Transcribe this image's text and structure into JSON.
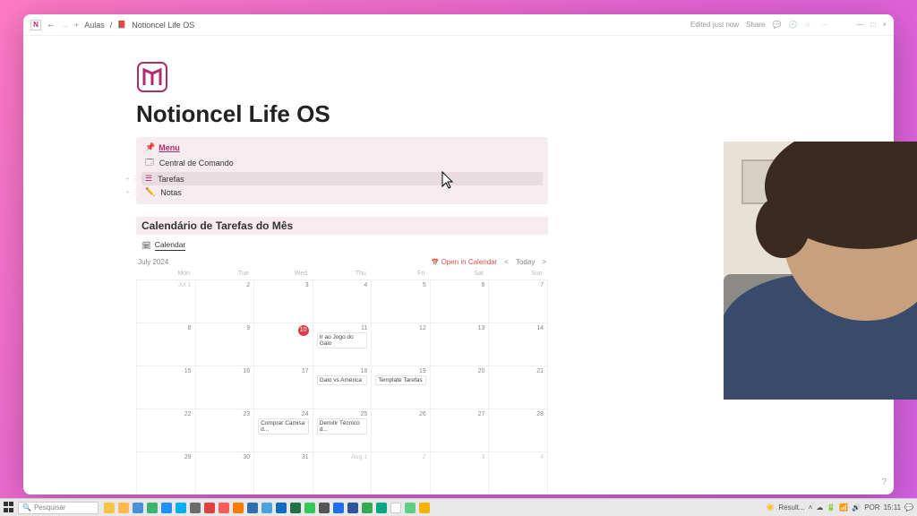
{
  "breadcrumbs": {
    "parent": "Aulas",
    "page": "Notioncel Life OS"
  },
  "toolbar": {
    "edited": "Edited just now",
    "share": "Share"
  },
  "page_title": "Notioncel Life OS",
  "menu": {
    "heading": "Menu",
    "central": "Central de Comando",
    "tarefas": "Tarefas",
    "notas": "Notas"
  },
  "calendar_section": "Calendário de Tarefas do Mês",
  "view_tab": "Calendar",
  "month_label": "July 2024",
  "open_in_calendar": "Open in Calendar",
  "today_label": "Today",
  "weekdays": [
    "Mon",
    "Tue",
    "Wed",
    "Thu",
    "Fri",
    "Sat",
    "Sun"
  ],
  "cells": {
    "r0c0": "Jul 1",
    "r0c1": "2",
    "r0c2": "3",
    "r0c3": "4",
    "r0c4": "5",
    "r0c5": "6",
    "r0c6": "7",
    "r1c0": "8",
    "r1c1": "9",
    "r1c2_today": "10",
    "r1c3": "11",
    "r1c4": "12",
    "r1c5": "13",
    "r1c6": "14",
    "r2c0": "15",
    "r2c1": "16",
    "r2c2": "17",
    "r2c3": "18",
    "r2c4": "19",
    "r2c5": "20",
    "r2c6": "21",
    "r3c0": "22",
    "r3c1": "23",
    "r3c2": "24",
    "r3c3": "25",
    "r3c4": "26",
    "r3c5": "27",
    "r3c6": "28",
    "r4c0": "29",
    "r4c1": "30",
    "r4c2": "31",
    "r4c3": "Aug 1",
    "r4c4": "2",
    "r4c5": "3",
    "r4c6": "4"
  },
  "events": {
    "jogo_galo": "Ir ao Jogo do Galo",
    "galo_america": "Galo vs América",
    "template_tarefas": "Template Tarefas",
    "comprar_camisa": "Comprar Camisa d...",
    "demitir_tecnico": "Demitir Técnico d..."
  },
  "taskbar": {
    "search_placeholder": "Pesquisar",
    "result": "Result...",
    "lang": "POR",
    "time": "15:11"
  }
}
